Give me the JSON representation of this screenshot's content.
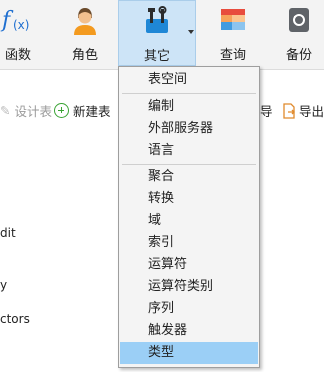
{
  "ribbon": {
    "functions": "函数",
    "roles": "角色",
    "other": "其它",
    "query": "查询",
    "backup": "备份"
  },
  "toolbar": {
    "design_table": "设计表",
    "new_table": "新建表",
    "export_wizard_tail": "导",
    "export_cut": "导出"
  },
  "background_list": [
    "dit",
    "y",
    "ctors"
  ],
  "other_menu": {
    "items": [
      "表空间",
      "编制",
      "外部服务器",
      "语言",
      "聚合",
      "转换",
      "域",
      "索引",
      "运算符",
      "运算符类别",
      "序列",
      "触发器",
      "类型"
    ],
    "selected": "类型"
  },
  "colors": {
    "ribbon_bg": "#f3f3f3",
    "active_tab_bg": "#cde4f7",
    "menu_bg": "#f4f4f4",
    "menu_highlight": "#9bcff6",
    "new_icon_green": "#3aa335"
  }
}
